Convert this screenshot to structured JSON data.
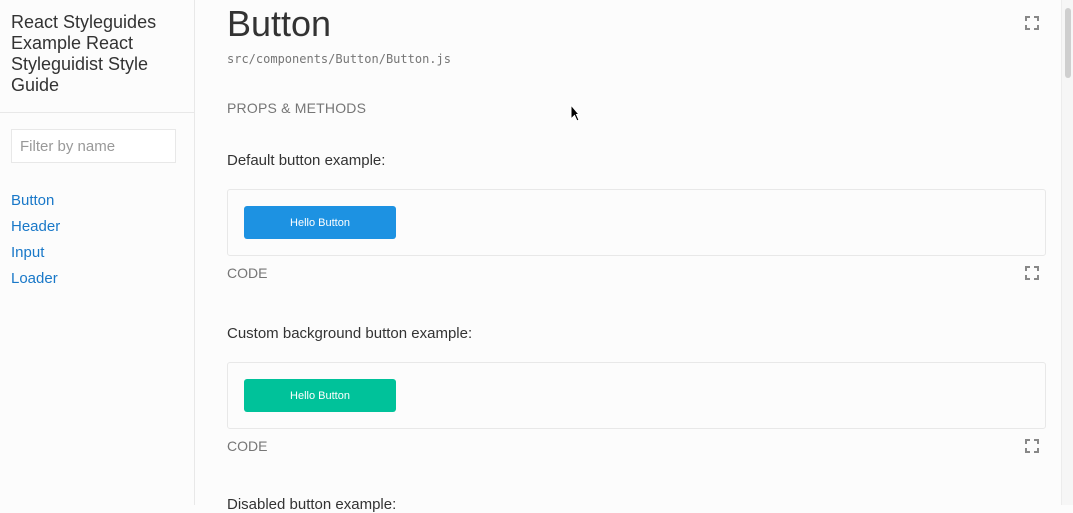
{
  "sidebar": {
    "title": "React Styleguides Example React Styleguidist Style Guide",
    "filter": {
      "placeholder": "Filter by name",
      "value": ""
    },
    "items": [
      {
        "label": "Button"
      },
      {
        "label": "Header"
      },
      {
        "label": "Input"
      },
      {
        "label": "Loader"
      }
    ]
  },
  "main": {
    "title": "Button",
    "path": "src/components/Button/Button.js",
    "props_toggle": "PROPS & METHODS",
    "examples": [
      {
        "label": "Default button example:",
        "button_label": "Hello Button",
        "button_color": "#1d92e2",
        "code_toggle": "CODE"
      },
      {
        "label": "Custom background button example:",
        "button_label": "Hello Button",
        "button_color": "#00c29a",
        "code_toggle": "CODE"
      }
    ],
    "next_example_label": "Disabled button example:"
  },
  "colors": {
    "link": "#1978c8",
    "muted": "#767676",
    "border": "#e8e8e8"
  }
}
